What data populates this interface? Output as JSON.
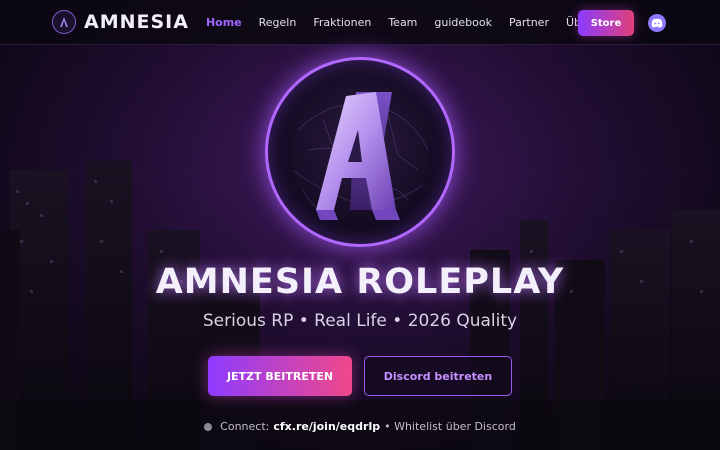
{
  "brand": {
    "name": "AMNESIA",
    "logo_letter": "A"
  },
  "nav": {
    "items": [
      {
        "label": "Home",
        "active": true
      },
      {
        "label": "Regeln",
        "active": false
      },
      {
        "label": "Fraktionen",
        "active": false
      },
      {
        "label": "Team",
        "active": false
      },
      {
        "label": "guidebook",
        "active": false
      },
      {
        "label": "Partner",
        "active": false
      },
      {
        "label": "Über uns",
        "active": false
      }
    ],
    "store_label": "Store",
    "discord_icon": "discord-icon"
  },
  "hero": {
    "logo_letter": "A",
    "title": "AMNESIA ROLEPLAY",
    "subtitle": "Serious RP • Real Life • 2026 Quality",
    "primary_button": "JETZT BEITRETEN",
    "secondary_button": "Discord beitreten"
  },
  "connect": {
    "prefix": "Connect:",
    "url": "cfx.re/join/eqdrlp",
    "suffix": "• Whitelist über Discord"
  },
  "colors": {
    "accent": "#a064ff",
    "gradient_start": "#8e3cff",
    "gradient_end": "#f0488a",
    "background": "#0c0812"
  }
}
